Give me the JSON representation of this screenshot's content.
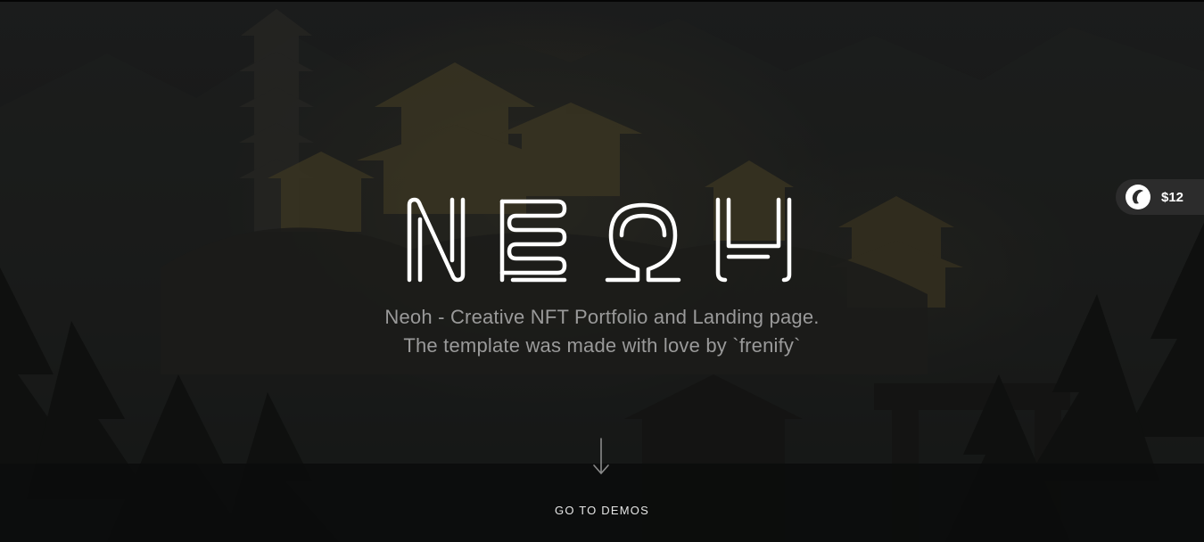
{
  "hero": {
    "logo_text": "NEOH",
    "subtitle_line1": "Neoh - Creative NFT Portfolio and Landing page.",
    "subtitle_line2": "The template was made with love by `frenify`",
    "cta_label": "GO TO DEMOS"
  },
  "price_badge": {
    "icon": "envato-market-icon",
    "price": "$12"
  },
  "colors": {
    "background": "#161717",
    "text_muted": "#9a9a9a",
    "text_light": "#e6e6e6",
    "badge_bg": "#2c2c2c"
  }
}
